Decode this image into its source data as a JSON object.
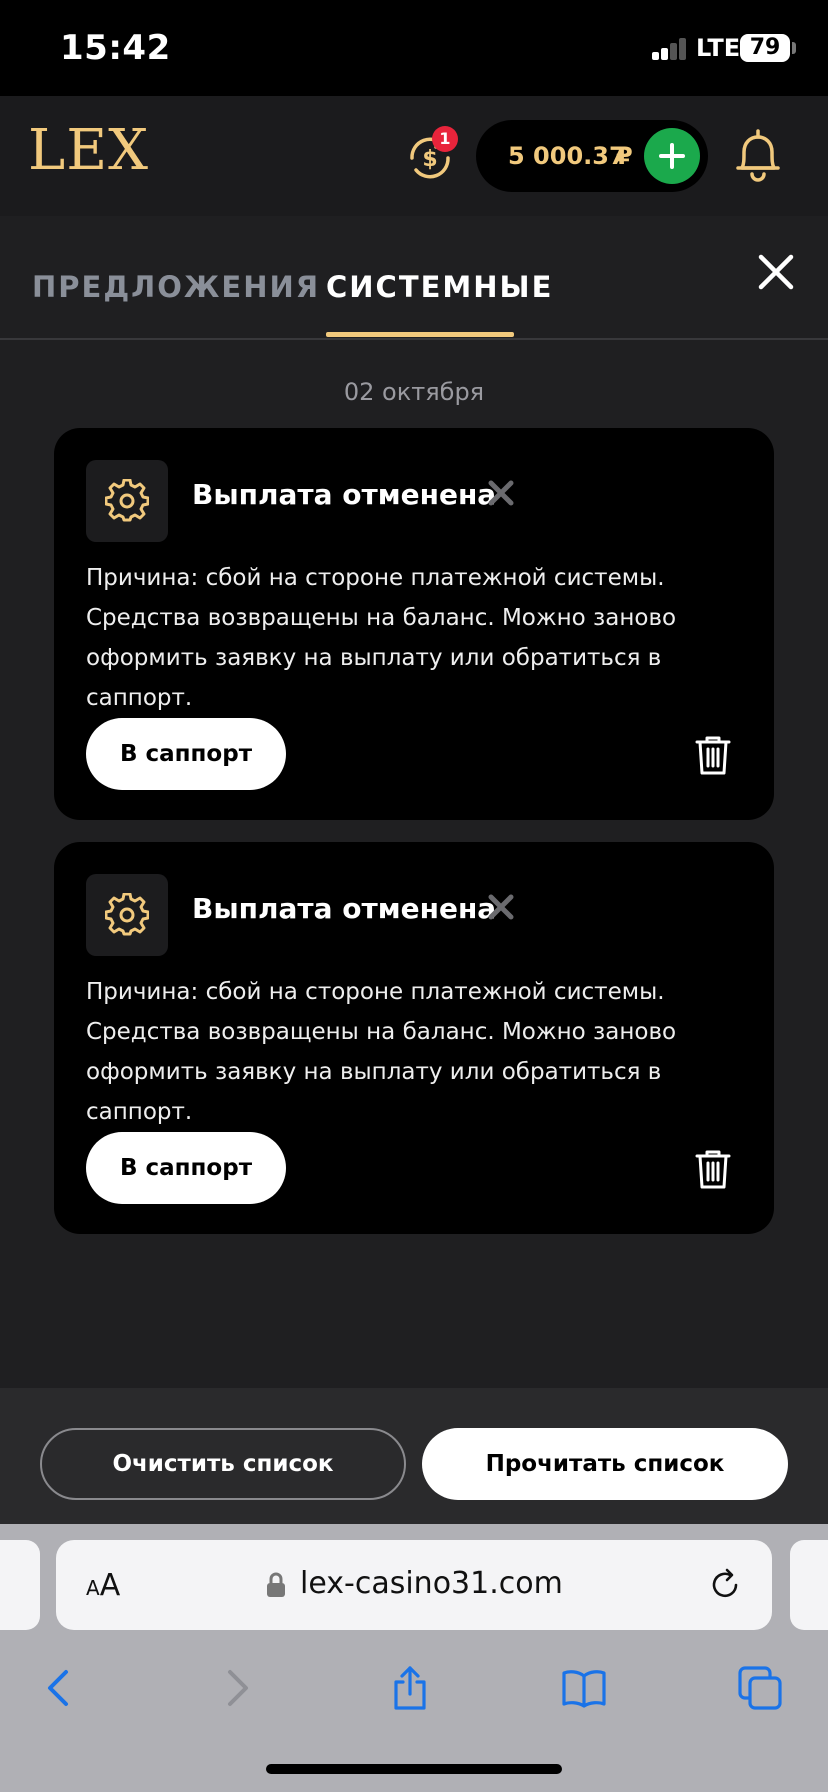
{
  "status_bar": {
    "time": "15:42",
    "network": "LTE",
    "battery": "79"
  },
  "header": {
    "logo": "LEX",
    "cashback_badge": "1",
    "balance_amount": "5 000.37",
    "balance_currency": "₽"
  },
  "tabs": {
    "offers": "ПРЕДЛОЖЕНИЯ",
    "system": "СИСТЕМНЫЕ",
    "active": "system"
  },
  "date_label": "02 октября",
  "notifications": [
    {
      "title": "Выплата отменена",
      "text": "Причина: сбой на стороне платежной системы. Средства возвращены на баланс. Можно заново оформить заявку на выплату или обратиться в саппорт.",
      "action_label": "В саппорт"
    },
    {
      "title": "Выплата отменена",
      "text": "Причина: сбой на стороне платежной системы. Средства возвращены на баланс. Можно заново оформить заявку на выплату или обратиться в саппорт.",
      "action_label": "В саппорт"
    }
  ],
  "bottom_actions": {
    "clear_label": "Очистить список",
    "read_label": "Прочитать список"
  },
  "browser": {
    "aa_label_small": "A",
    "aa_label_large": "A",
    "url": "lex-casino31.com"
  },
  "colors": {
    "accent": "#f1c97d",
    "deposit": "#1ba94c",
    "badge": "#e8243b",
    "link_blue": "#1a73e8"
  }
}
